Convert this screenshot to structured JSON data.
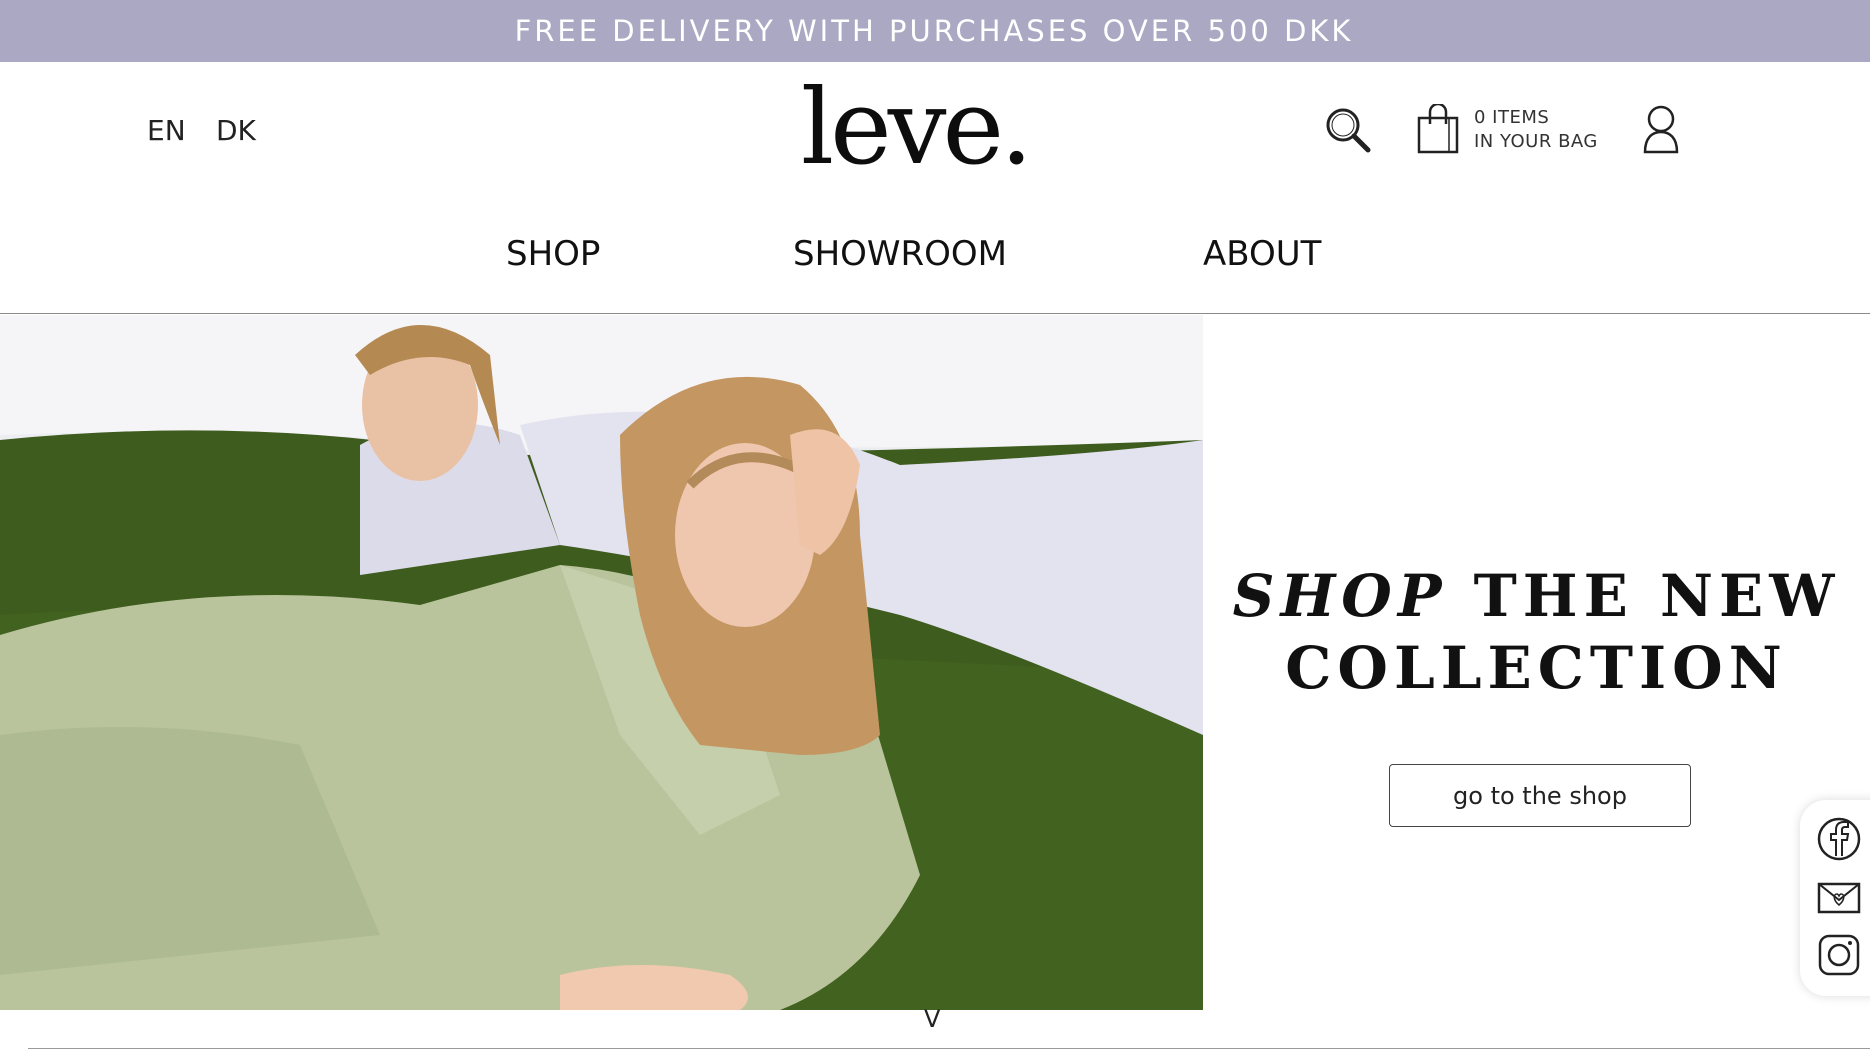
{
  "promo": {
    "text": "FREE DELIVERY WITH PURCHASES OVER 500 DKK",
    "background": "#aaa8c3"
  },
  "header": {
    "languages": [
      "EN",
      "DK"
    ],
    "logo": "leve.",
    "bag": {
      "line1": "0 ITEMS",
      "line2": "IN YOUR BAG"
    },
    "icons": [
      "search-icon",
      "bag-icon",
      "user-icon"
    ]
  },
  "nav": {
    "items": [
      "SHOP",
      "SHOWROOM",
      "ABOUT"
    ]
  },
  "hero": {
    "headline_italic": "SHOP",
    "headline_rest": "THE NEW",
    "headline_line2": "COLLECTION",
    "button_label": "go to the shop",
    "image_alt_colors": {
      "suit_green": "#b9c49c",
      "suit_lilac": "#e3e2ef",
      "grass": "#3e5c1e"
    }
  },
  "social": {
    "icons": [
      "facebook-icon",
      "mail-icon",
      "instagram-icon"
    ]
  },
  "scroll": {
    "label": "V"
  }
}
